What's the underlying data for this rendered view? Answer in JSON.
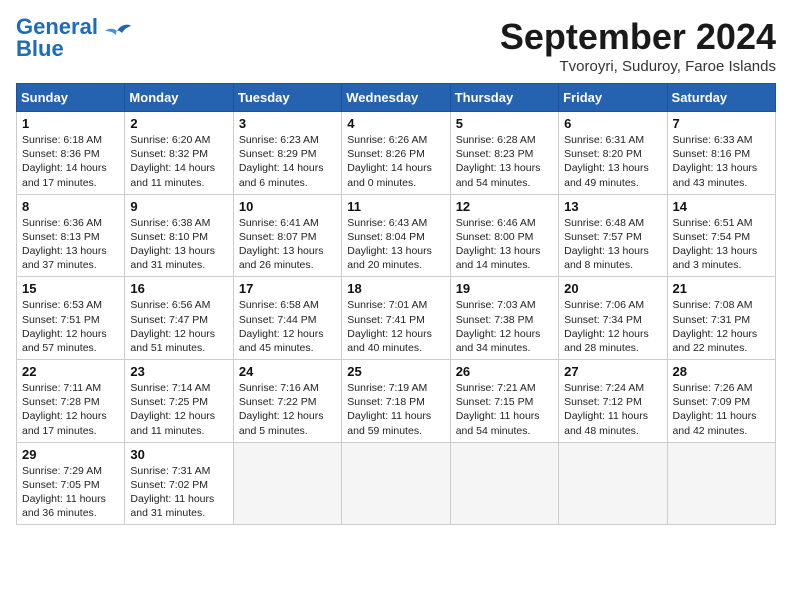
{
  "header": {
    "logo_line1": "General",
    "logo_line2": "Blue",
    "month_title": "September 2024",
    "subtitle": "Tvoroyri, Suduroy, Faroe Islands"
  },
  "weekdays": [
    "Sunday",
    "Monday",
    "Tuesday",
    "Wednesday",
    "Thursday",
    "Friday",
    "Saturday"
  ],
  "weeks": [
    [
      {
        "day": "1",
        "info": "Sunrise: 6:18 AM\nSunset: 8:36 PM\nDaylight: 14 hours\nand 17 minutes."
      },
      {
        "day": "2",
        "info": "Sunrise: 6:20 AM\nSunset: 8:32 PM\nDaylight: 14 hours\nand 11 minutes."
      },
      {
        "day": "3",
        "info": "Sunrise: 6:23 AM\nSunset: 8:29 PM\nDaylight: 14 hours\nand 6 minutes."
      },
      {
        "day": "4",
        "info": "Sunrise: 6:26 AM\nSunset: 8:26 PM\nDaylight: 14 hours\nand 0 minutes."
      },
      {
        "day": "5",
        "info": "Sunrise: 6:28 AM\nSunset: 8:23 PM\nDaylight: 13 hours\nand 54 minutes."
      },
      {
        "day": "6",
        "info": "Sunrise: 6:31 AM\nSunset: 8:20 PM\nDaylight: 13 hours\nand 49 minutes."
      },
      {
        "day": "7",
        "info": "Sunrise: 6:33 AM\nSunset: 8:16 PM\nDaylight: 13 hours\nand 43 minutes."
      }
    ],
    [
      {
        "day": "8",
        "info": "Sunrise: 6:36 AM\nSunset: 8:13 PM\nDaylight: 13 hours\nand 37 minutes."
      },
      {
        "day": "9",
        "info": "Sunrise: 6:38 AM\nSunset: 8:10 PM\nDaylight: 13 hours\nand 31 minutes."
      },
      {
        "day": "10",
        "info": "Sunrise: 6:41 AM\nSunset: 8:07 PM\nDaylight: 13 hours\nand 26 minutes."
      },
      {
        "day": "11",
        "info": "Sunrise: 6:43 AM\nSunset: 8:04 PM\nDaylight: 13 hours\nand 20 minutes."
      },
      {
        "day": "12",
        "info": "Sunrise: 6:46 AM\nSunset: 8:00 PM\nDaylight: 13 hours\nand 14 minutes."
      },
      {
        "day": "13",
        "info": "Sunrise: 6:48 AM\nSunset: 7:57 PM\nDaylight: 13 hours\nand 8 minutes."
      },
      {
        "day": "14",
        "info": "Sunrise: 6:51 AM\nSunset: 7:54 PM\nDaylight: 13 hours\nand 3 minutes."
      }
    ],
    [
      {
        "day": "15",
        "info": "Sunrise: 6:53 AM\nSunset: 7:51 PM\nDaylight: 12 hours\nand 57 minutes."
      },
      {
        "day": "16",
        "info": "Sunrise: 6:56 AM\nSunset: 7:47 PM\nDaylight: 12 hours\nand 51 minutes."
      },
      {
        "day": "17",
        "info": "Sunrise: 6:58 AM\nSunset: 7:44 PM\nDaylight: 12 hours\nand 45 minutes."
      },
      {
        "day": "18",
        "info": "Sunrise: 7:01 AM\nSunset: 7:41 PM\nDaylight: 12 hours\nand 40 minutes."
      },
      {
        "day": "19",
        "info": "Sunrise: 7:03 AM\nSunset: 7:38 PM\nDaylight: 12 hours\nand 34 minutes."
      },
      {
        "day": "20",
        "info": "Sunrise: 7:06 AM\nSunset: 7:34 PM\nDaylight: 12 hours\nand 28 minutes."
      },
      {
        "day": "21",
        "info": "Sunrise: 7:08 AM\nSunset: 7:31 PM\nDaylight: 12 hours\nand 22 minutes."
      }
    ],
    [
      {
        "day": "22",
        "info": "Sunrise: 7:11 AM\nSunset: 7:28 PM\nDaylight: 12 hours\nand 17 minutes."
      },
      {
        "day": "23",
        "info": "Sunrise: 7:14 AM\nSunset: 7:25 PM\nDaylight: 12 hours\nand 11 minutes."
      },
      {
        "day": "24",
        "info": "Sunrise: 7:16 AM\nSunset: 7:22 PM\nDaylight: 12 hours\nand 5 minutes."
      },
      {
        "day": "25",
        "info": "Sunrise: 7:19 AM\nSunset: 7:18 PM\nDaylight: 11 hours\nand 59 minutes."
      },
      {
        "day": "26",
        "info": "Sunrise: 7:21 AM\nSunset: 7:15 PM\nDaylight: 11 hours\nand 54 minutes."
      },
      {
        "day": "27",
        "info": "Sunrise: 7:24 AM\nSunset: 7:12 PM\nDaylight: 11 hours\nand 48 minutes."
      },
      {
        "day": "28",
        "info": "Sunrise: 7:26 AM\nSunset: 7:09 PM\nDaylight: 11 hours\nand 42 minutes."
      }
    ],
    [
      {
        "day": "29",
        "info": "Sunrise: 7:29 AM\nSunset: 7:05 PM\nDaylight: 11 hours\nand 36 minutes."
      },
      {
        "day": "30",
        "info": "Sunrise: 7:31 AM\nSunset: 7:02 PM\nDaylight: 11 hours\nand 31 minutes."
      },
      {
        "day": "",
        "info": ""
      },
      {
        "day": "",
        "info": ""
      },
      {
        "day": "",
        "info": ""
      },
      {
        "day": "",
        "info": ""
      },
      {
        "day": "",
        "info": ""
      }
    ]
  ]
}
